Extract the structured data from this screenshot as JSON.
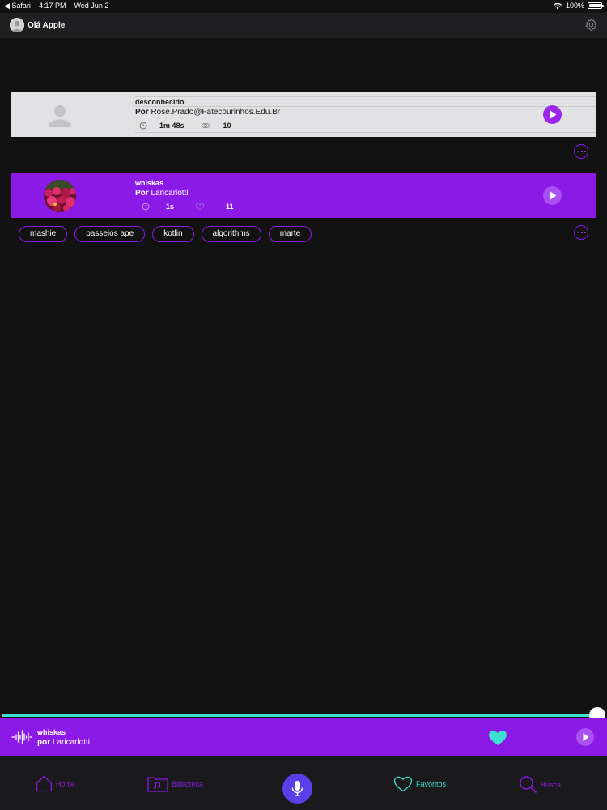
{
  "status_bar": {
    "back_app": "◀ Safari",
    "time": "4:17 PM",
    "date": "Wed Jun 2",
    "battery": "100%"
  },
  "header": {
    "greeting": "Olá Apple"
  },
  "recordings": [
    {
      "title": "desconhecido",
      "author_prefix": "Por",
      "author": "Rose.Prado@Fatecourinhos.Edu.Br",
      "duration": "1m 48s",
      "count": "10"
    },
    {
      "title": "whiskas",
      "author_prefix": "Por",
      "author": "Laricarlotti",
      "duration": "1s",
      "count": "11",
      "tags": [
        "mashie",
        "passeios ape",
        "kotlin",
        "algorithms",
        "marte"
      ]
    }
  ],
  "now_playing": {
    "title": "whiskas",
    "author_prefix": "por",
    "author": "Laricarlotti",
    "progress": 1.0
  },
  "tabs": [
    {
      "label": "Home",
      "icon": "home-icon"
    },
    {
      "label": "Biblioteca",
      "icon": "library-icon"
    },
    {
      "label": "Favoritos",
      "icon": "heart-icon"
    },
    {
      "label": "Busca",
      "icon": "search-icon"
    }
  ],
  "colors": {
    "accent": "#8c1ae6",
    "progress": "#3ce0d0",
    "mic": "#5a3fe8",
    "favorite": "#3ce0d0"
  }
}
